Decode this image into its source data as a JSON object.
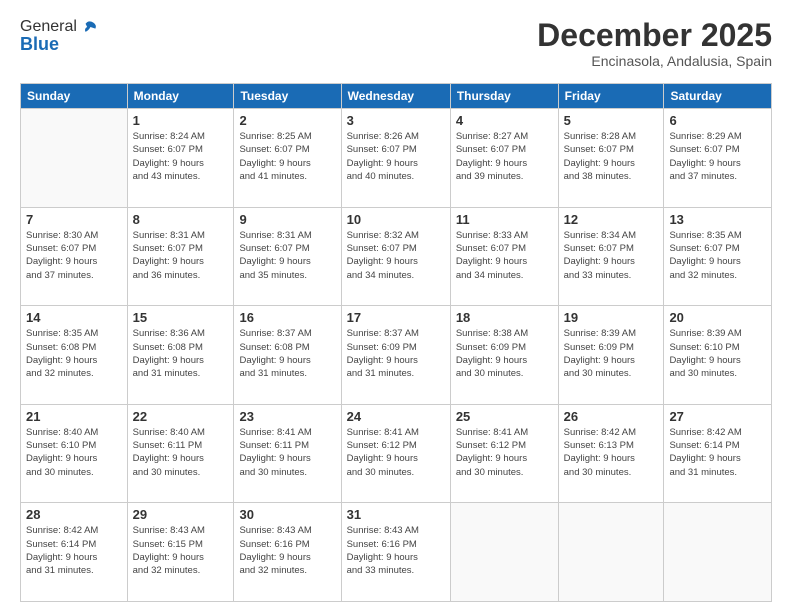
{
  "header": {
    "logo": {
      "general": "General",
      "blue": "Blue"
    },
    "title": "December 2025",
    "subtitle": "Encinasola, Andalusia, Spain"
  },
  "calendar": {
    "days_of_week": [
      "Sunday",
      "Monday",
      "Tuesday",
      "Wednesday",
      "Thursday",
      "Friday",
      "Saturday"
    ],
    "weeks": [
      [
        {
          "day": "",
          "info": ""
        },
        {
          "day": "1",
          "info": "Sunrise: 8:24 AM\nSunset: 6:07 PM\nDaylight: 9 hours\nand 43 minutes."
        },
        {
          "day": "2",
          "info": "Sunrise: 8:25 AM\nSunset: 6:07 PM\nDaylight: 9 hours\nand 41 minutes."
        },
        {
          "day": "3",
          "info": "Sunrise: 8:26 AM\nSunset: 6:07 PM\nDaylight: 9 hours\nand 40 minutes."
        },
        {
          "day": "4",
          "info": "Sunrise: 8:27 AM\nSunset: 6:07 PM\nDaylight: 9 hours\nand 39 minutes."
        },
        {
          "day": "5",
          "info": "Sunrise: 8:28 AM\nSunset: 6:07 PM\nDaylight: 9 hours\nand 38 minutes."
        },
        {
          "day": "6",
          "info": "Sunrise: 8:29 AM\nSunset: 6:07 PM\nDaylight: 9 hours\nand 37 minutes."
        }
      ],
      [
        {
          "day": "7",
          "info": "Sunrise: 8:30 AM\nSunset: 6:07 PM\nDaylight: 9 hours\nand 37 minutes."
        },
        {
          "day": "8",
          "info": "Sunrise: 8:31 AM\nSunset: 6:07 PM\nDaylight: 9 hours\nand 36 minutes."
        },
        {
          "day": "9",
          "info": "Sunrise: 8:31 AM\nSunset: 6:07 PM\nDaylight: 9 hours\nand 35 minutes."
        },
        {
          "day": "10",
          "info": "Sunrise: 8:32 AM\nSunset: 6:07 PM\nDaylight: 9 hours\nand 34 minutes."
        },
        {
          "day": "11",
          "info": "Sunrise: 8:33 AM\nSunset: 6:07 PM\nDaylight: 9 hours\nand 34 minutes."
        },
        {
          "day": "12",
          "info": "Sunrise: 8:34 AM\nSunset: 6:07 PM\nDaylight: 9 hours\nand 33 minutes."
        },
        {
          "day": "13",
          "info": "Sunrise: 8:35 AM\nSunset: 6:07 PM\nDaylight: 9 hours\nand 32 minutes."
        }
      ],
      [
        {
          "day": "14",
          "info": "Sunrise: 8:35 AM\nSunset: 6:08 PM\nDaylight: 9 hours\nand 32 minutes."
        },
        {
          "day": "15",
          "info": "Sunrise: 8:36 AM\nSunset: 6:08 PM\nDaylight: 9 hours\nand 31 minutes."
        },
        {
          "day": "16",
          "info": "Sunrise: 8:37 AM\nSunset: 6:08 PM\nDaylight: 9 hours\nand 31 minutes."
        },
        {
          "day": "17",
          "info": "Sunrise: 8:37 AM\nSunset: 6:09 PM\nDaylight: 9 hours\nand 31 minutes."
        },
        {
          "day": "18",
          "info": "Sunrise: 8:38 AM\nSunset: 6:09 PM\nDaylight: 9 hours\nand 30 minutes."
        },
        {
          "day": "19",
          "info": "Sunrise: 8:39 AM\nSunset: 6:09 PM\nDaylight: 9 hours\nand 30 minutes."
        },
        {
          "day": "20",
          "info": "Sunrise: 8:39 AM\nSunset: 6:10 PM\nDaylight: 9 hours\nand 30 minutes."
        }
      ],
      [
        {
          "day": "21",
          "info": "Sunrise: 8:40 AM\nSunset: 6:10 PM\nDaylight: 9 hours\nand 30 minutes."
        },
        {
          "day": "22",
          "info": "Sunrise: 8:40 AM\nSunset: 6:11 PM\nDaylight: 9 hours\nand 30 minutes."
        },
        {
          "day": "23",
          "info": "Sunrise: 8:41 AM\nSunset: 6:11 PM\nDaylight: 9 hours\nand 30 minutes."
        },
        {
          "day": "24",
          "info": "Sunrise: 8:41 AM\nSunset: 6:12 PM\nDaylight: 9 hours\nand 30 minutes."
        },
        {
          "day": "25",
          "info": "Sunrise: 8:41 AM\nSunset: 6:12 PM\nDaylight: 9 hours\nand 30 minutes."
        },
        {
          "day": "26",
          "info": "Sunrise: 8:42 AM\nSunset: 6:13 PM\nDaylight: 9 hours\nand 30 minutes."
        },
        {
          "day": "27",
          "info": "Sunrise: 8:42 AM\nSunset: 6:14 PM\nDaylight: 9 hours\nand 31 minutes."
        }
      ],
      [
        {
          "day": "28",
          "info": "Sunrise: 8:42 AM\nSunset: 6:14 PM\nDaylight: 9 hours\nand 31 minutes."
        },
        {
          "day": "29",
          "info": "Sunrise: 8:43 AM\nSunset: 6:15 PM\nDaylight: 9 hours\nand 32 minutes."
        },
        {
          "day": "30",
          "info": "Sunrise: 8:43 AM\nSunset: 6:16 PM\nDaylight: 9 hours\nand 32 minutes."
        },
        {
          "day": "31",
          "info": "Sunrise: 8:43 AM\nSunset: 6:16 PM\nDaylight: 9 hours\nand 33 minutes."
        },
        {
          "day": "",
          "info": ""
        },
        {
          "day": "",
          "info": ""
        },
        {
          "day": "",
          "info": ""
        }
      ]
    ]
  }
}
